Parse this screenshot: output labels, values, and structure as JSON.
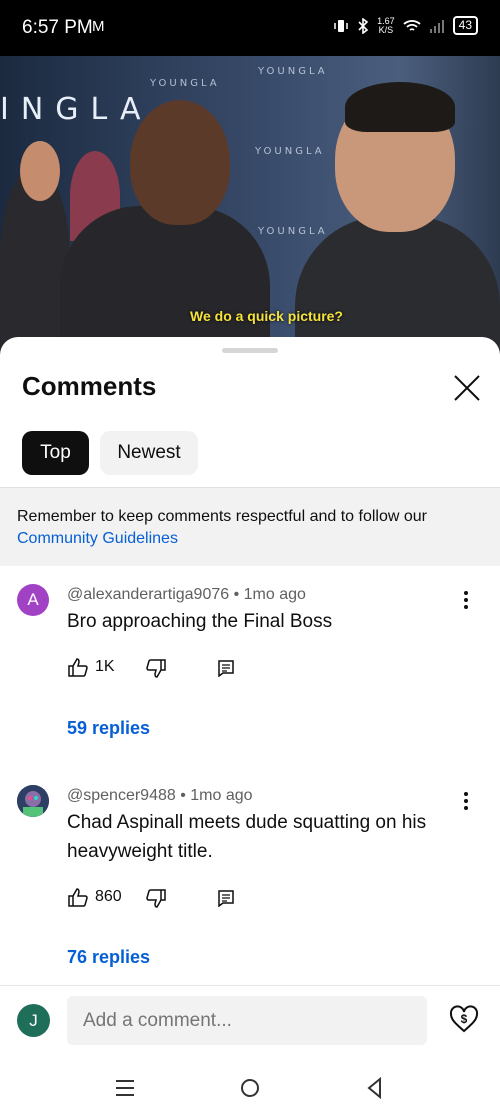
{
  "status": {
    "time": "6:57 PM",
    "mail_icon": "M",
    "net_speed_value": "1.67",
    "net_speed_unit": "K/S",
    "battery": "43"
  },
  "video": {
    "banner_word": "YOUNGLA",
    "big_letters": "INGLA",
    "caption": "We do a quick picture?"
  },
  "sheet": {
    "title": "Comments",
    "close_icon": "close-icon",
    "filters": [
      {
        "label": "Top",
        "selected": true
      },
      {
        "label": "Newest",
        "selected": false
      }
    ],
    "notice_text": "Remember to keep comments respectful and to follow our",
    "notice_link": "Community Guidelines"
  },
  "comments": [
    {
      "avatar_letter": "A",
      "avatar_color": "#a142c4",
      "author": "@alexanderartiga9076",
      "time": "1mo ago",
      "text": "Bro approaching the Final Boss",
      "likes": "1K",
      "replies": "59 replies"
    },
    {
      "avatar_letter": "",
      "avatar_color": "#3b4a6b",
      "author": "@spencer9488",
      "time": "1mo ago",
      "text": "Chad Aspinall meets dude squatting on his heavyweight title.",
      "likes": "860",
      "replies": "76 replies"
    }
  ],
  "composer": {
    "avatar_letter": "J",
    "placeholder": "Add a comment..."
  },
  "colors": {
    "link": "#065fd4",
    "chip_selected": "#0f0f0f",
    "chip_unselected": "#f2f2f2"
  }
}
